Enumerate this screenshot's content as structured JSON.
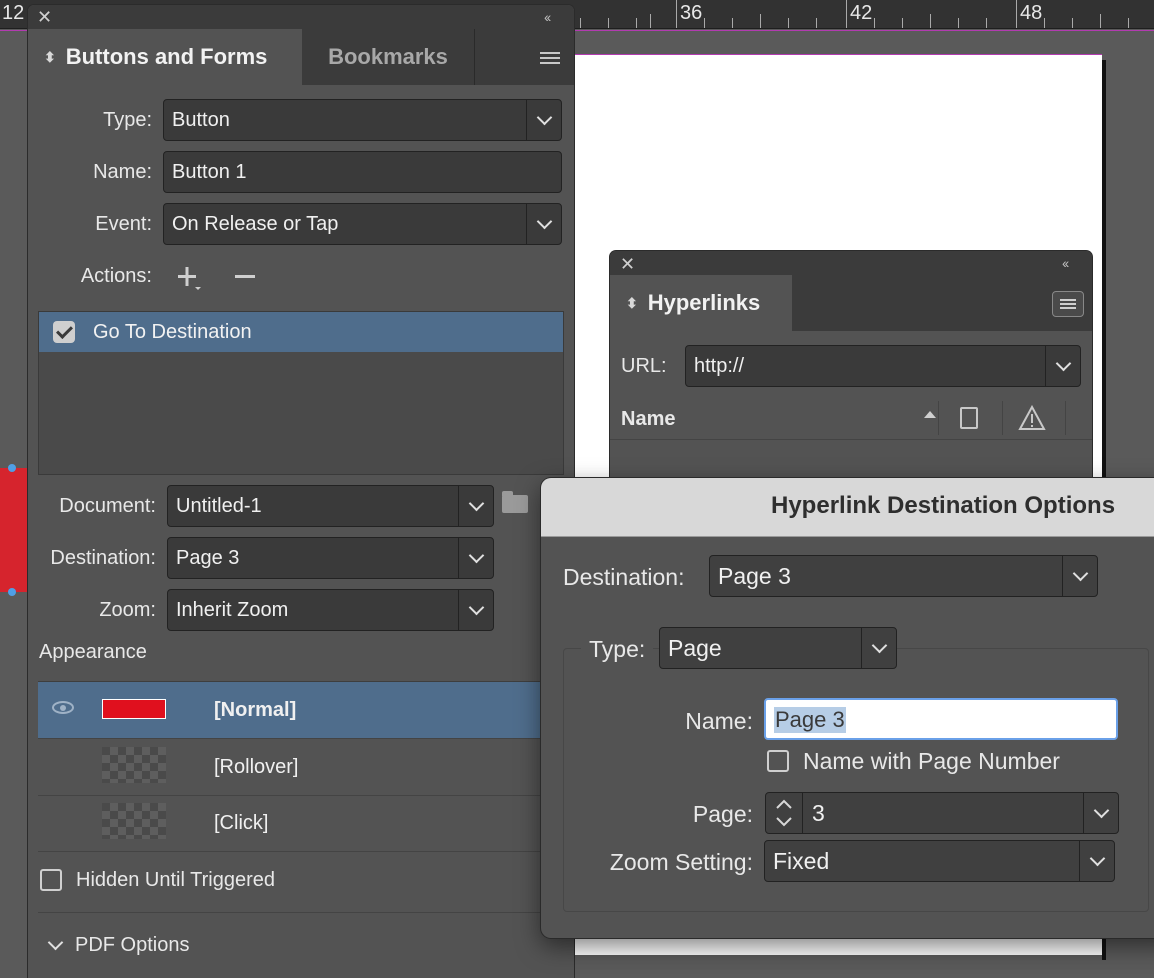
{
  "ruler": {
    "numbers": [
      "12",
      "36",
      "42",
      "48"
    ]
  },
  "buttons_forms_panel": {
    "tabs": [
      {
        "label": "Buttons and Forms"
      },
      {
        "label": "Bookmarks"
      }
    ],
    "type_label": "Type:",
    "type_value": "Button",
    "name_label": "Name:",
    "name_value": "Button 1",
    "event_label": "Event:",
    "event_value": "On Release or Tap",
    "actions_label": "Actions:",
    "actions": [
      {
        "label": "Go To Destination",
        "checked": true
      }
    ],
    "document_label": "Document:",
    "document_value": "Untitled-1",
    "destination_label": "Destination:",
    "destination_value": "Page 3",
    "zoom_label": "Zoom:",
    "zoom_value": "Inherit Zoom",
    "appearance_label": "Appearance",
    "appearance_states": [
      {
        "label": "[Normal]"
      },
      {
        "label": "[Rollover]"
      },
      {
        "label": "[Click]"
      }
    ],
    "hidden_until_triggered": "Hidden Until Triggered",
    "pdf_options": "PDF Options"
  },
  "hyperlinks_panel": {
    "title": "Hyperlinks",
    "url_label": "URL:",
    "url_value": "http://",
    "name_column": "Name"
  },
  "dialog": {
    "title": "Hyperlink Destination Options",
    "destination_label": "Destination:",
    "destination_value": "Page 3",
    "type_label": "Type:",
    "type_value": "Page",
    "name_label": "Name:",
    "name_value": "Page 3",
    "name_with_page_number": "Name with Page Number",
    "page_label": "Page:",
    "page_value": "3",
    "zoom_label": "Zoom Setting:",
    "zoom_value": "Fixed"
  },
  "colors": {
    "panel_bg": "#535353",
    "selection_blue": "#4f6d8c",
    "normal_swatch": "#e0101e",
    "guide_magenta": "#b23bb0"
  }
}
